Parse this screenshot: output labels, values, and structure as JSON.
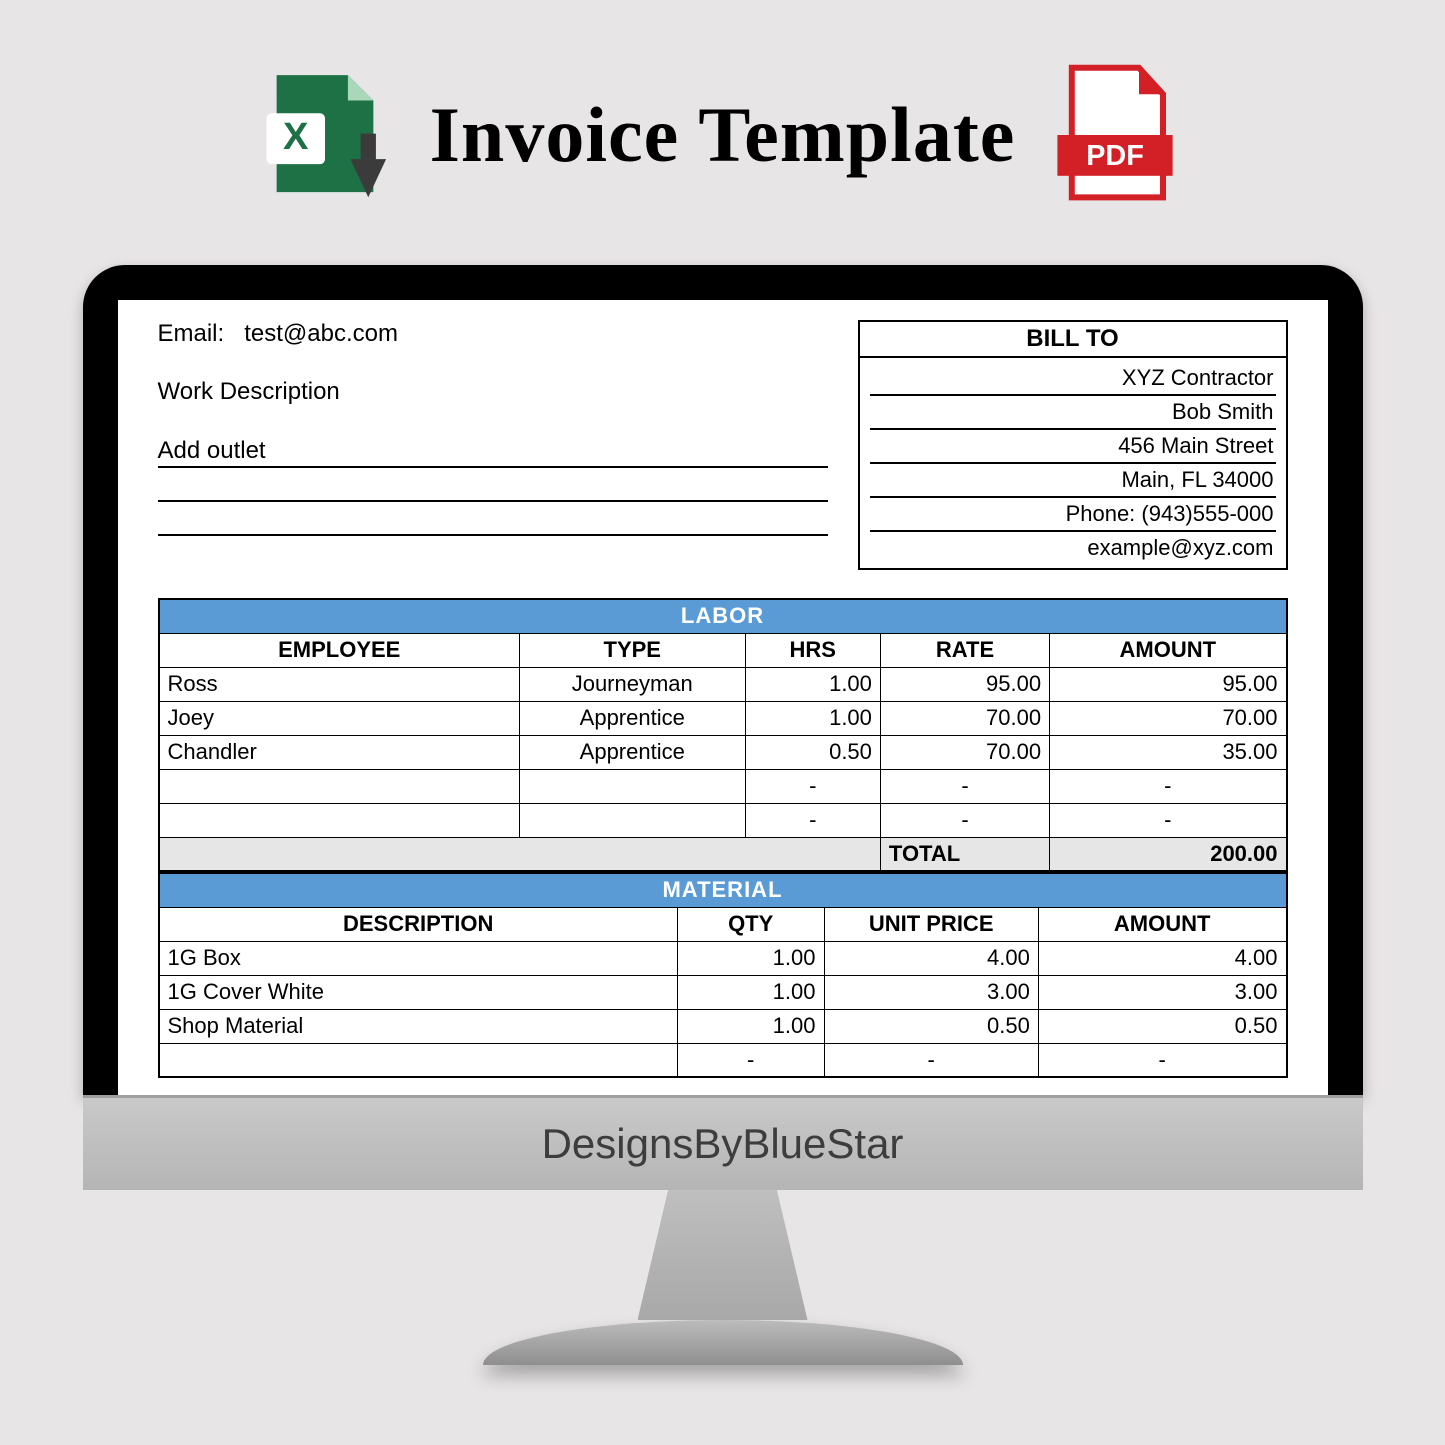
{
  "header": {
    "title": "Invoice Template",
    "excel_label": "X",
    "pdf_label": "PDF"
  },
  "brand": "DesignsByBlueStar",
  "contact": {
    "email_label": "Email:",
    "email_value": "test@abc.com",
    "work_desc_label": "Work Description",
    "work_desc_lines": [
      "Add outlet",
      "",
      ""
    ]
  },
  "bill_to": {
    "header": "BILL TO",
    "lines": [
      "XYZ Contractor",
      "Bob Smith",
      "456 Main Street",
      "Main, FL 34000",
      "Phone: (943)555-000",
      "example@xyz.com"
    ]
  },
  "labor": {
    "title": "LABOR",
    "columns": [
      "EMPLOYEE",
      "TYPE",
      "HRS",
      "RATE",
      "AMOUNT"
    ],
    "rows": [
      {
        "employee": "Ross",
        "type": "Journeyman",
        "hrs": "1.00",
        "rate": "95.00",
        "amount": "95.00"
      },
      {
        "employee": "Joey",
        "type": "Apprentice",
        "hrs": "1.00",
        "rate": "70.00",
        "amount": "70.00"
      },
      {
        "employee": "Chandler",
        "type": "Apprentice",
        "hrs": "0.50",
        "rate": "70.00",
        "amount": "35.00"
      },
      {
        "employee": "",
        "type": "",
        "hrs": "-",
        "rate": "-",
        "amount": "-"
      },
      {
        "employee": "",
        "type": "",
        "hrs": "-",
        "rate": "-",
        "amount": "-"
      }
    ],
    "total_label": "TOTAL",
    "total_value": "200.00"
  },
  "material": {
    "title": "MATERIAL",
    "columns": [
      "DESCRIPTION",
      "QTY",
      "UNIT PRICE",
      "AMOUNT"
    ],
    "rows": [
      {
        "desc": "1G Box",
        "qty": "1.00",
        "unit": "4.00",
        "amount": "4.00"
      },
      {
        "desc": "1G Cover White",
        "qty": "1.00",
        "unit": "3.00",
        "amount": "3.00"
      },
      {
        "desc": "Shop Material",
        "qty": "1.00",
        "unit": "0.50",
        "amount": "0.50"
      },
      {
        "desc": "",
        "qty": "-",
        "unit": "-",
        "amount": "-"
      }
    ]
  }
}
